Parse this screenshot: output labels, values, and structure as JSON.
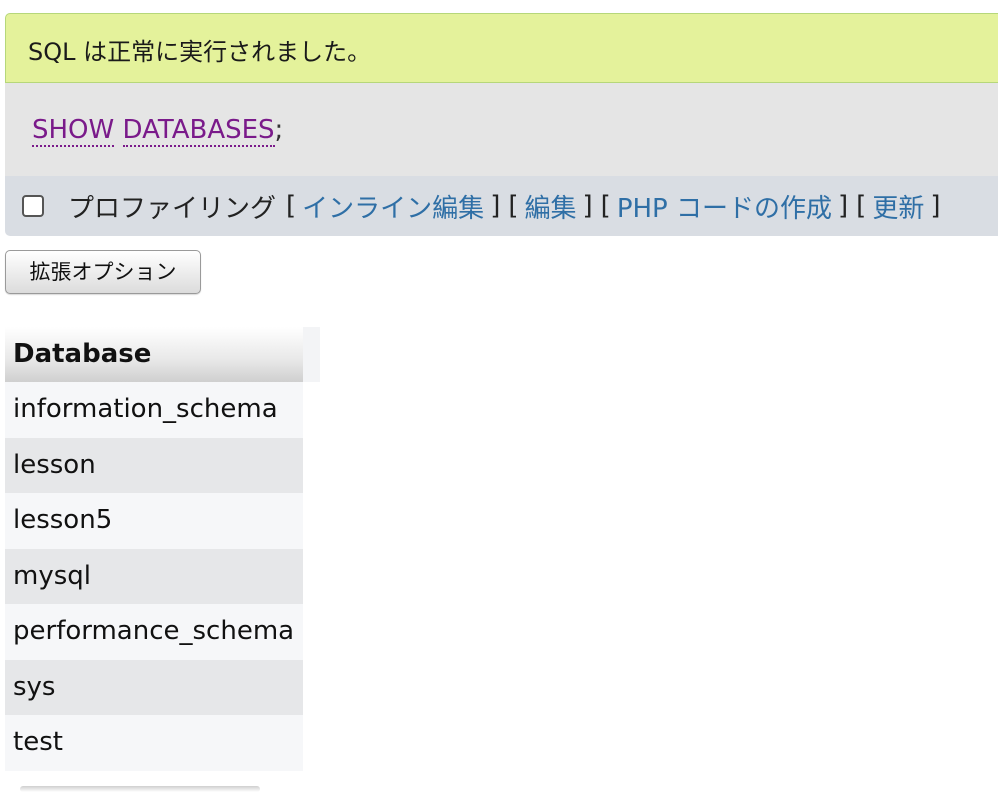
{
  "success_message": "SQL は正常に実行されました。",
  "sql": {
    "keyword1": "SHOW",
    "keyword2": "DATABASES",
    "terminator": ";"
  },
  "tools": {
    "profiling_label": "プロファイリング",
    "profiling_checked": false,
    "bracket_open": "[",
    "bracket_close": "]",
    "links": {
      "inline_edit": "インライン編集",
      "edit": "編集",
      "create_php_code": "PHP コードの作成",
      "refresh": "更新"
    }
  },
  "options_button": "拡張オプション",
  "results": {
    "column": "Database",
    "rows": [
      "information_schema",
      "lesson",
      "lesson5",
      "mysql",
      "performance_schema",
      "sys",
      "test"
    ]
  },
  "colors": {
    "success_bg": "#e4f29b",
    "sql_bg": "#e5e5e5",
    "tools_bg": "#d9dde3",
    "link": "#2f6fa6",
    "sql_keyword": "#7a1a8a"
  }
}
